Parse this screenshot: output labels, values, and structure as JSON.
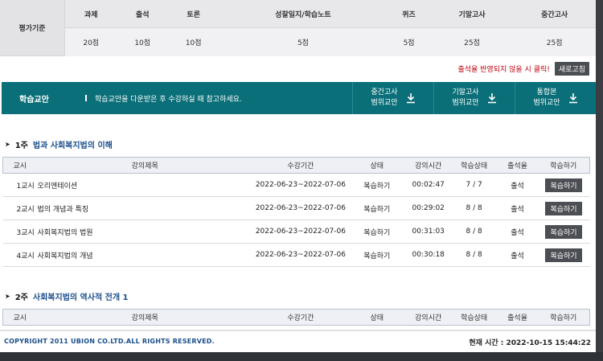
{
  "evaluation": {
    "label": "평가기준",
    "columns": [
      {
        "name": "과제",
        "score": "20점"
      },
      {
        "name": "출석",
        "score": "10점"
      },
      {
        "name": "토론",
        "score": "10점"
      },
      {
        "name": "성찰일지/학습노트",
        "score": "5점"
      },
      {
        "name": "퀴즈",
        "score": "5점"
      },
      {
        "name": "기말고사",
        "score": "25점"
      },
      {
        "name": "중간고사",
        "score": "25점"
      }
    ]
  },
  "notice": {
    "text": "출석율 반영되지 않을 시 클릭!",
    "refresh_label": "새로고침"
  },
  "materials_bar": {
    "title": "학습교안",
    "description": "학습교안을 다운받은 후 수강하실 때 참고하세요.",
    "downloads": [
      {
        "line1": "중간고사",
        "line2": "범위교안",
        "icon": "download-icon"
      },
      {
        "line1": "기말고사",
        "line2": "범위교안",
        "icon": "download-icon"
      },
      {
        "line1": "통합본",
        "line2": "범위교안",
        "icon": "download-icon"
      }
    ]
  },
  "table_headers": [
    "교시",
    "강의제목",
    "수강기간",
    "상태",
    "강의시간",
    "학습상태",
    "출석율",
    "학습하기"
  ],
  "weeks": [
    {
      "label": "1주",
      "title": "법과 사회복지법의 이해",
      "lectures": [
        {
          "no": "1교시",
          "title": "오리엔테이션",
          "period": "2022-06-23~2022-07-06",
          "status": "복습하기",
          "duration": "00:02:47",
          "progress": "7 / 7",
          "attendance": "출석",
          "action": "복습하기"
        },
        {
          "no": "2교시",
          "title": "법의 개념과 특징",
          "period": "2022-06-23~2022-07-06",
          "status": "복습하기",
          "duration": "00:29:02",
          "progress": "8 / 8",
          "attendance": "출석",
          "action": "복습하기"
        },
        {
          "no": "3교시",
          "title": "사회복지법의 법원",
          "period": "2022-06-23~2022-07-06",
          "status": "복습하기",
          "duration": "00:31:03",
          "progress": "8 / 8",
          "attendance": "출석",
          "action": "복습하기"
        },
        {
          "no": "4교시",
          "title": "사회복지법의 개념",
          "period": "2022-06-23~2022-07-06",
          "status": "복습하기",
          "duration": "00:30:18",
          "progress": "8 / 8",
          "attendance": "출석",
          "action": "복습하기"
        }
      ]
    },
    {
      "label": "2주",
      "title": "사회복지법의 역사적 전개 1",
      "lectures": []
    }
  ],
  "footer": {
    "copyright": "COPYRIGHT 2011 UBION CO.LTD.ALL RIGHTS RESERVED.",
    "clock_label": "현재 시간 :",
    "clock_value": "2022-10-15 15:44:22"
  },
  "colors": {
    "teal": "#0a6f78",
    "link_blue": "#1b4f8e",
    "notice_red": "#c0000a"
  }
}
